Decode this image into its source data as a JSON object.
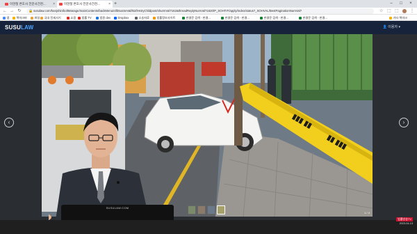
{
  "browser": {
    "tabs": [
      {
        "title": "이현철 변호사 전문사건천..."
      },
      {
        "title": "이현철 변호사 전문사건천..."
      }
    ],
    "url": "susulaw.com/hanjshin/boltManage/mainContents/backMenu/el/b5usSeVal/l62/lHstryChildpost/shurmVal?162&threadReplyNumVal?1620/P_SOHTrF/apply/index/status?_SOHVAL/BestPaginationNumVal?"
  },
  "bookmarks": [
    {
      "label": "앱",
      "color": "#4a8af4"
    },
    {
      "label": "북마크바",
      "color": "#f4b400"
    },
    {
      "label": "파일",
      "color": "#e8a33d"
    },
    {
      "label": "국내 전세사기",
      "color": "#e8a33d"
    },
    {
      "label": "쇼핑",
      "color": "#d93025"
    },
    {
      "label": "법률 TV",
      "color": "#d93025"
    },
    {
      "label": "법원 dev",
      "color": "#1a73e8"
    },
    {
      "label": "Dropbox",
      "color": "#0061ff"
    },
    {
      "label": "소송자료",
      "color": "#5f6368"
    },
    {
      "label": "법률정보사이트",
      "color": "#f29900"
    },
    {
      "label": "판결문 검색 - 판결...",
      "color": "#188038"
    },
    {
      "label": "판결문 검색 - 판결...",
      "color": "#188038"
    },
    {
      "label": "판결문 검색 - 판결...",
      "color": "#188038"
    },
    {
      "label": "판결문 검색 - 판결...",
      "color": "#188038"
    },
    {
      "label": "기타 북마크",
      "color": "#f4b400"
    }
  ],
  "site": {
    "logo_main": "SUSU",
    "logo_accent": "LAW",
    "user_label": "이용자"
  },
  "viewer": {
    "page_count": "1 / 4"
  },
  "monitor_brand": "SUSULAW.COM",
  "taskbar": {
    "channel": "법률방송TV",
    "date": "2023-04-13"
  },
  "colors": {
    "header_bg": "#17233a",
    "accent": "#4aa3ff",
    "tape_yellow": "#f2cf1d"
  }
}
